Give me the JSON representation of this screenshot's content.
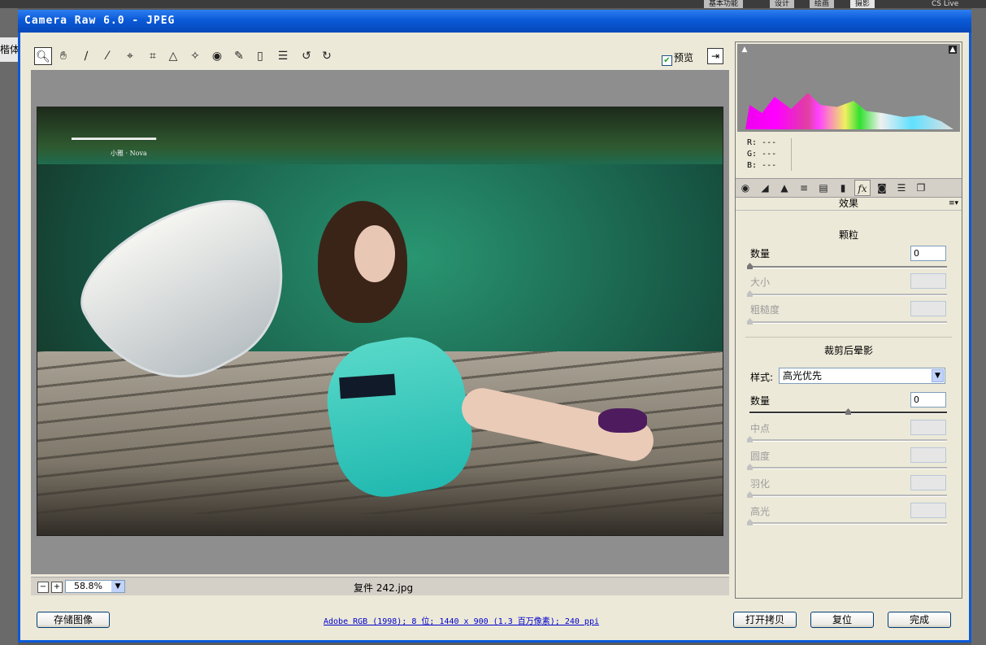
{
  "host": {
    "left_tab": "楷体",
    "workspace_tabs": [
      "基本功能",
      "设计",
      "绘画",
      "摄影"
    ],
    "cs_live": "CS Live"
  },
  "dialog": {
    "title": "Camera Raw 6.0 -  JPEG",
    "preview_label": "预览",
    "preview_checked": true
  },
  "toolbar": {
    "tools": [
      "zoom-icon",
      "hand-icon",
      "white-balance-icon",
      "color-sampler-icon",
      "target-adjust-icon",
      "crop-icon",
      "straighten-icon",
      "spot-removal-icon",
      "red-eye-icon",
      "adjustment-brush-icon",
      "graduated-filter-icon",
      "preferences-icon",
      "rotate-left-icon",
      "rotate-right-icon"
    ]
  },
  "image_overlay": {
    "logo_text": "小雅 · Nova"
  },
  "zoom": {
    "value": "58.8%",
    "filename": "复件 242.jpg"
  },
  "panel": {
    "rgb": {
      "r": "R:  ---",
      "g": "G:  ---",
      "b": "B:  ---"
    },
    "section_title": "效果",
    "grain": {
      "title": "颗粒",
      "amount_label": "数量",
      "amount_value": "0",
      "size_label": "大小",
      "roughness_label": "粗糙度"
    },
    "vignette": {
      "title": "裁剪后晕影",
      "style_label": "样式:",
      "style_value": "高光优先",
      "amount_label": "数量",
      "amount_value": "0",
      "midpoint_label": "中点",
      "roundness_label": "圆度",
      "feather_label": "羽化",
      "highlights_label": "高光"
    }
  },
  "footer": {
    "save_label": "存储图像",
    "info_text": "Adobe RGB (1998); 8 位; 1440 x 900 (1.3 百万像素); 240 ppi",
    "open_copy_label": "打开拷贝",
    "reset_label": "复位",
    "done_label": "完成"
  }
}
